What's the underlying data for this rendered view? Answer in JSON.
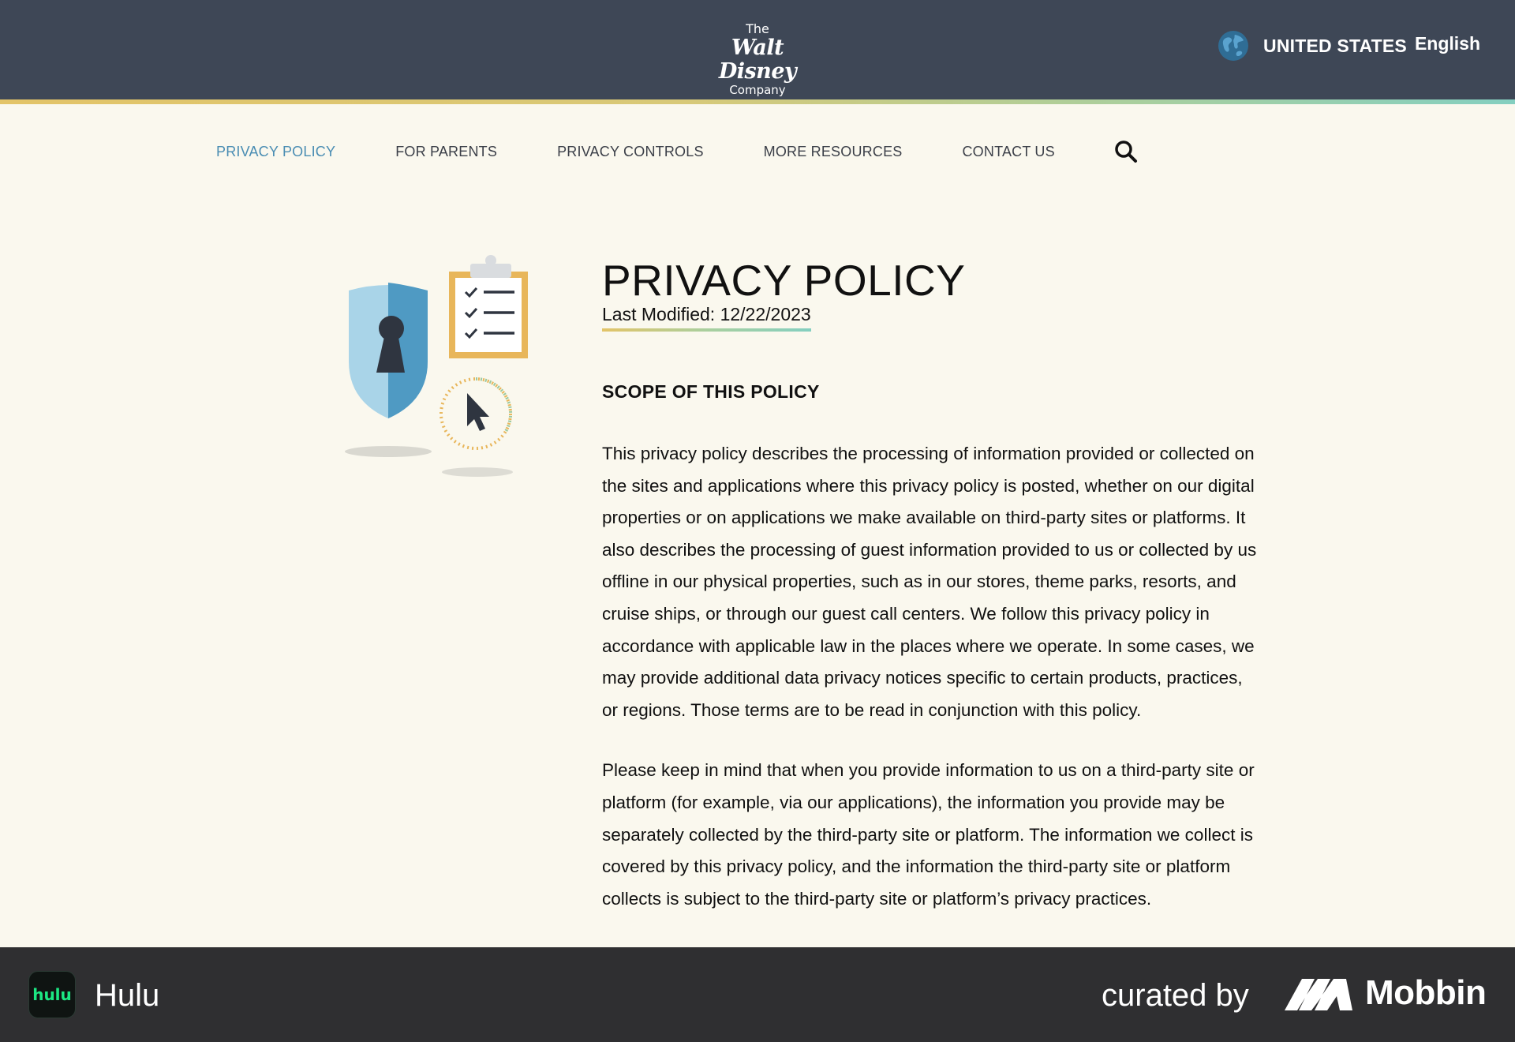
{
  "header": {
    "logo": {
      "line1": "The",
      "line2": "Walt Disney",
      "line3": "Company"
    },
    "region": {
      "icon": "globe-icon",
      "country": "UNITED STATES",
      "language": "English"
    }
  },
  "nav": {
    "items": [
      {
        "label": "PRIVACY POLICY",
        "active": true
      },
      {
        "label": "FOR PARENTS",
        "active": false
      },
      {
        "label": "PRIVACY CONTROLS",
        "active": false
      },
      {
        "label": "MORE RESOURCES",
        "active": false
      },
      {
        "label": "CONTACT US",
        "active": false
      }
    ],
    "search_icon": "search-icon",
    "active_color": "#4a8db3"
  },
  "main": {
    "title": "PRIVACY POLICY",
    "last_modified": "Last Modified: 12/22/2023",
    "section_heading": "SCOPE OF THIS POLICY",
    "paragraphs": [
      "This privacy policy describes the processing of information provided or collected on the sites and applications where this privacy policy is posted, whether on our digital properties or on applications we make available on third-party sites or plat­forms. It also describes the processing of guest information provided to us or col­lected by us offline in our physical properties, such as in our stores, theme parks, resorts, and cruise ships, or through our guest call centers. We follow this privacy policy in accordance with applicable law in the places where we operate. In some cases, we may provide additional data privacy notices specific to certain prod­ucts, practices, or regions. Those terms are to be read in conjunction with this policy.",
      "Please keep in mind that when you provide information to us on a third-party site or platform (for example, via our applications), the information you provide may be separately collected by the third-party site or platform. The information we col­lect is covered by this privacy policy, and the information the third-party site or platform collects is subject to the third-party site or platform’s privacy practices."
    ]
  },
  "colors": {
    "header_bg": "#3e4756",
    "page_bg": "#faf8ee",
    "footer_bg": "#2f2f31",
    "hulu_green": "#1ce783"
  },
  "footer": {
    "app_icon_text": "hulu",
    "app_name": "Hulu",
    "curated_by": "curated by",
    "brand": "Mobbin"
  }
}
